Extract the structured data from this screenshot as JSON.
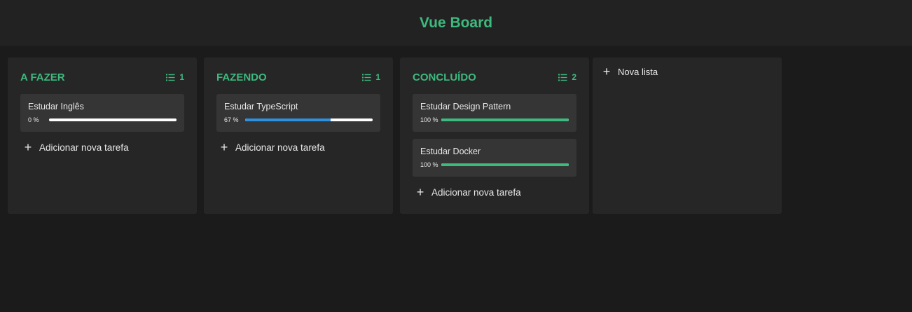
{
  "app": {
    "title": "Vue Board"
  },
  "colors": {
    "accent": "#3dba7e",
    "progress_blue": "#2e90e0",
    "track": "#ffffff"
  },
  "lists": [
    {
      "title": "A FAZER",
      "count": "1",
      "count_icon": "list-icon",
      "cards": [
        {
          "title": "Estudar Inglês",
          "progress_label": "0 %",
          "progress": 0
        }
      ],
      "add_label": "Adicionar nova tarefa"
    },
    {
      "title": "FAZENDO",
      "count": "1",
      "count_icon": "list-icon",
      "cards": [
        {
          "title": "Estudar TypeScript",
          "progress_label": "67 %",
          "progress": 67
        }
      ],
      "add_label": "Adicionar nova tarefa"
    },
    {
      "title": "CONCLUÍDO",
      "count": "2",
      "count_icon": "list-icon",
      "cards": [
        {
          "title": "Estudar Design Pattern",
          "progress_label": "100 %",
          "progress": 100
        },
        {
          "title": "Estudar Docker",
          "progress_label": "100 %",
          "progress": 100
        }
      ],
      "add_label": "Adicionar nova tarefa"
    }
  ],
  "new_list": {
    "label": "Nova lista",
    "icon": "plus-icon"
  }
}
